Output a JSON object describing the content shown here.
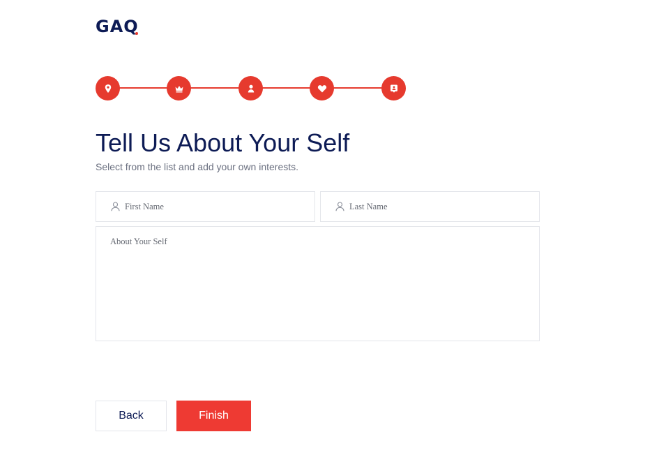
{
  "brand": {
    "logo_text": "GAQ",
    "accent_color": "#e63a2e",
    "navy_color": "#0d1b55"
  },
  "stepper": {
    "steps": [
      {
        "icon": "map-pin-icon"
      },
      {
        "icon": "crown-icon"
      },
      {
        "icon": "user-icon"
      },
      {
        "icon": "heart-icon"
      },
      {
        "icon": "contact-card-icon"
      }
    ]
  },
  "header": {
    "title": "Tell Us About Your Self",
    "subtitle": "Select from the list and add your own interests."
  },
  "form": {
    "first_name": {
      "placeholder": "First Name",
      "value": "",
      "icon": "user-outline-icon"
    },
    "last_name": {
      "placeholder": "Last Name",
      "value": "",
      "icon": "user-outline-icon"
    },
    "about": {
      "placeholder": "About Your Self",
      "value": ""
    }
  },
  "actions": {
    "back_label": "Back",
    "finish_label": "Finish"
  }
}
